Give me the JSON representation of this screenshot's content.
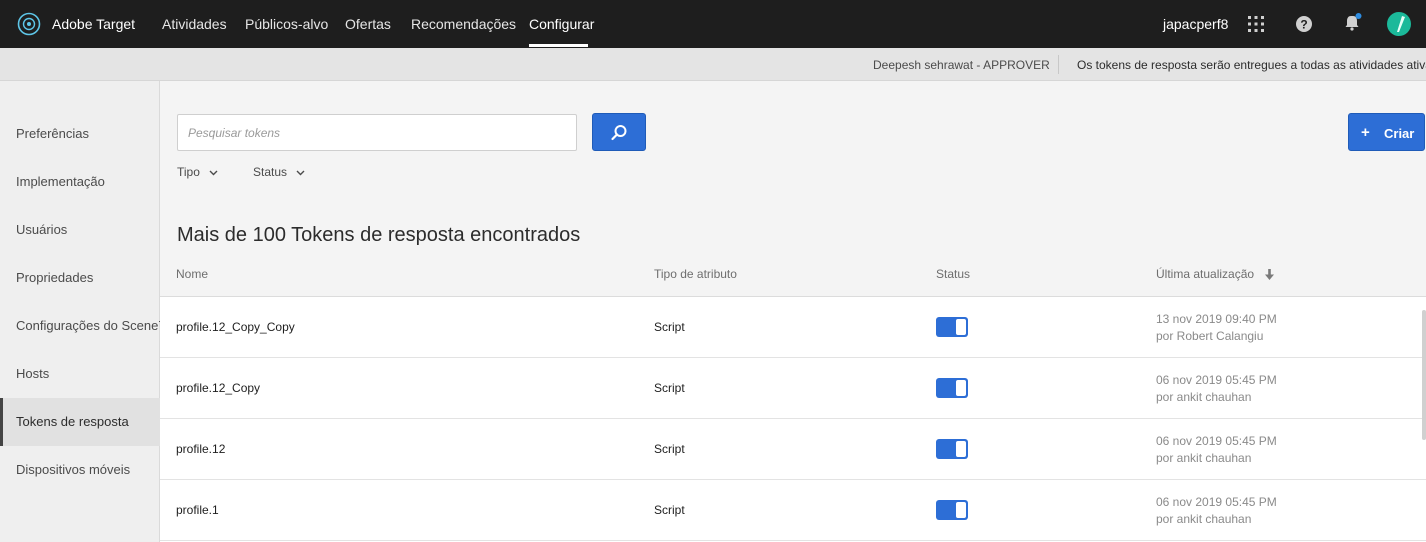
{
  "app": {
    "title": "Adobe Target",
    "nav": [
      "Atividades",
      "Públicos-alvo",
      "Ofertas",
      "Recomendações",
      "Configurar"
    ],
    "active_nav": "Configurar",
    "user": "japacperf8",
    "accent_color": "#2d6ed6"
  },
  "infobar": {
    "user_role": "Deepesh sehrawat - APPROVER",
    "message": "Os tokens de resposta serão entregues a todas as atividades ativas"
  },
  "sidebar": {
    "items": [
      {
        "label": "Preferências"
      },
      {
        "label": "Implementação"
      },
      {
        "label": "Usuários"
      },
      {
        "label": "Propriedades"
      },
      {
        "label": "Configurações do Scene7"
      },
      {
        "label": "Hosts"
      },
      {
        "label": "Tokens de resposta"
      },
      {
        "label": "Dispositivos móveis"
      }
    ],
    "active": "Tokens de resposta"
  },
  "search": {
    "placeholder": "Pesquisar tokens",
    "value": ""
  },
  "create_label": "Criar",
  "filters": [
    "Tipo",
    "Status"
  ],
  "result_title": "Mais de 100 Tokens de resposta encontrados",
  "table": {
    "headers": [
      "Nome",
      "Tipo de atributo",
      "Status",
      "Última atualização"
    ],
    "sort_column": "Última atualização",
    "sort_direction": "descending",
    "rows": [
      {
        "name": "profile.12_Copy_Copy",
        "type": "Script",
        "status_on": true,
        "date": "13 nov 2019 09:40 PM",
        "by": "por Robert Calangiu"
      },
      {
        "name": "profile.12_Copy",
        "type": "Script",
        "status_on": true,
        "date": "06 nov 2019 05:45 PM",
        "by": "por ankit chauhan"
      },
      {
        "name": "profile.12",
        "type": "Script",
        "status_on": true,
        "date": "06 nov 2019 05:45 PM",
        "by": "por ankit chauhan"
      },
      {
        "name": "profile.1",
        "type": "Script",
        "status_on": true,
        "date": "06 nov 2019 05:45 PM",
        "by": "por ankit chauhan"
      }
    ]
  },
  "icons": {
    "logo": "adobe-target-logo-icon",
    "apps": "apps-grid-icon",
    "help": "help-icon",
    "notifications": "bell-icon",
    "avatar": "avatar-icon",
    "search": "search-icon",
    "chevron": "chevron-down-icon",
    "sort": "sort-arrow-down-icon"
  }
}
